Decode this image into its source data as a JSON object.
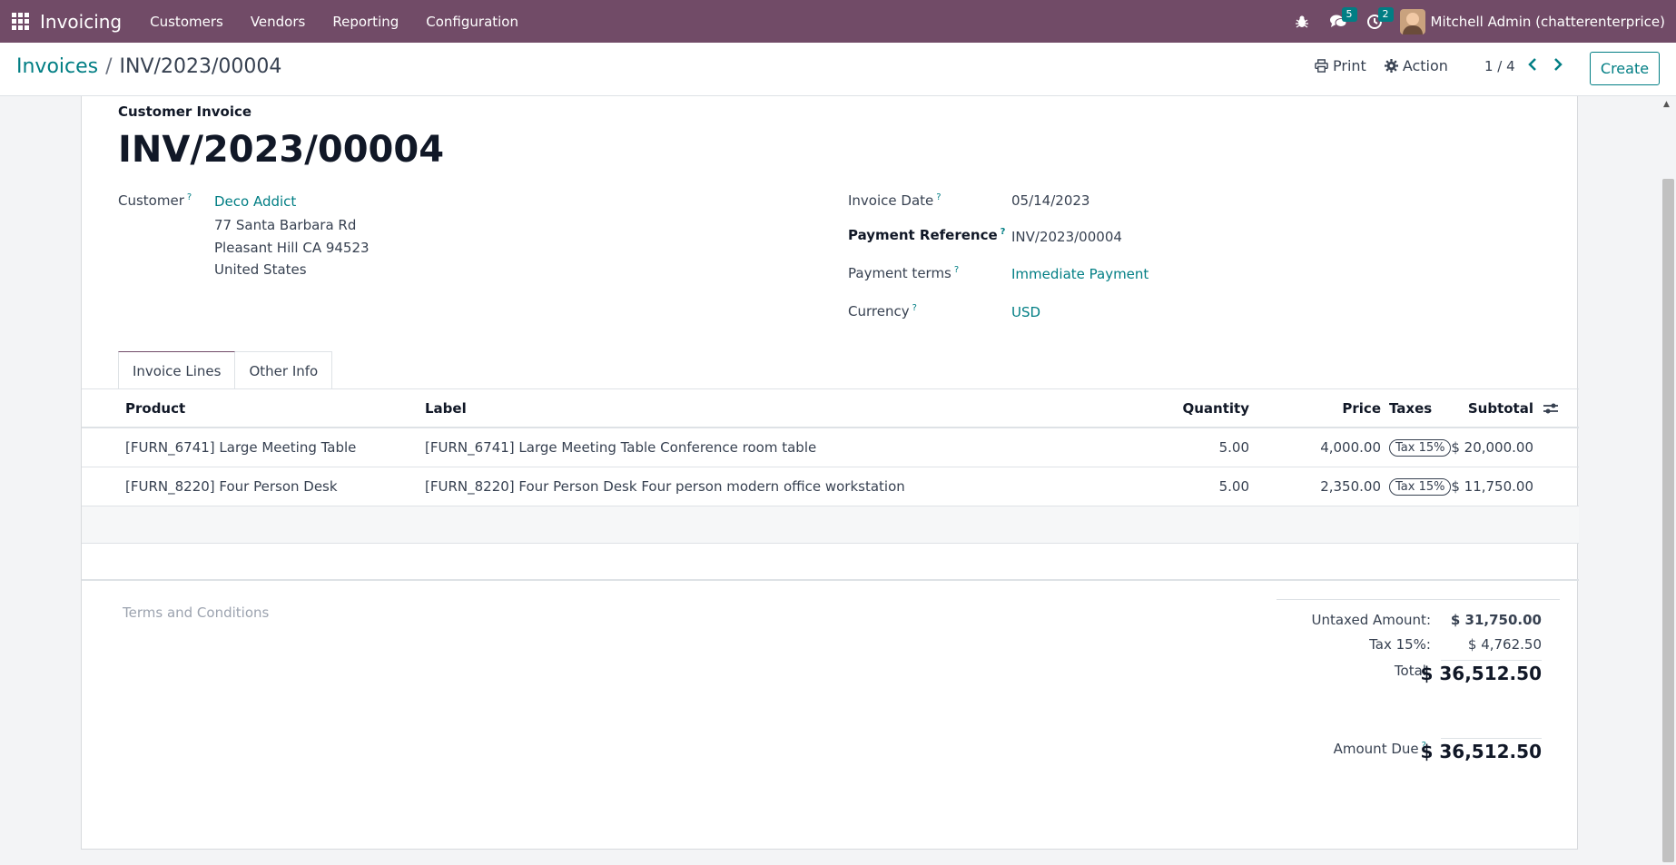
{
  "navbar": {
    "app_name": "Invoicing",
    "menu": [
      "Customers",
      "Vendors",
      "Reporting",
      "Configuration"
    ],
    "messages_count": "5",
    "activities_count": "2",
    "user_name": "Mitchell Admin (chatterenterprice)"
  },
  "breadcrumb": {
    "parent": "Invoices",
    "separator": "/",
    "current": "INV/2023/00004"
  },
  "control": {
    "print_label": "Print",
    "action_label": "Action",
    "pager": "1 / 4",
    "create_label": "Create"
  },
  "invoice": {
    "type": "Customer Invoice",
    "name": "INV/2023/00004",
    "customer_label": "Customer",
    "customer_name": "Deco Addict",
    "address": [
      "77 Santa Barbara Rd",
      "Pleasant Hill CA 94523",
      "United States"
    ],
    "invoice_date_label": "Invoice Date",
    "invoice_date": "05/14/2023",
    "payment_ref_label": "Payment Reference",
    "payment_ref": "INV/2023/00004",
    "payment_terms_label": "Payment terms",
    "payment_terms": "Immediate Payment",
    "currency_label": "Currency",
    "currency": "USD"
  },
  "tabs": [
    "Invoice Lines",
    "Other Info"
  ],
  "lines_table": {
    "headers": {
      "product": "Product",
      "label": "Label",
      "quantity": "Quantity",
      "price": "Price",
      "taxes": "Taxes",
      "subtotal": "Subtotal"
    },
    "rows": [
      {
        "product": "[FURN_6741] Large Meeting Table",
        "label": "[FURN_6741] Large Meeting Table Conference room table",
        "quantity": "5.00",
        "price": "4,000.00",
        "tax": "Tax 15%",
        "subtotal": "$ 20,000.00"
      },
      {
        "product": "[FURN_8220] Four Person Desk",
        "label": "[FURN_8220] Four Person Desk Four person modern office workstation",
        "quantity": "5.00",
        "price": "2,350.00",
        "tax": "Tax 15%",
        "subtotal": "$ 11,750.00"
      }
    ]
  },
  "terms_placeholder": "Terms and Conditions",
  "totals": {
    "untaxed_label": "Untaxed Amount:",
    "untaxed": "$ 31,750.00",
    "tax_label": "Tax 15%:",
    "tax": "$ 4,762.50",
    "total_label": "Total:",
    "total": "$ 36,512.50",
    "amount_due_label": "Amount Due",
    "amount_due": "$ 36,512.50"
  },
  "colors": {
    "brand": "#714b67",
    "accent": "#017e84"
  }
}
